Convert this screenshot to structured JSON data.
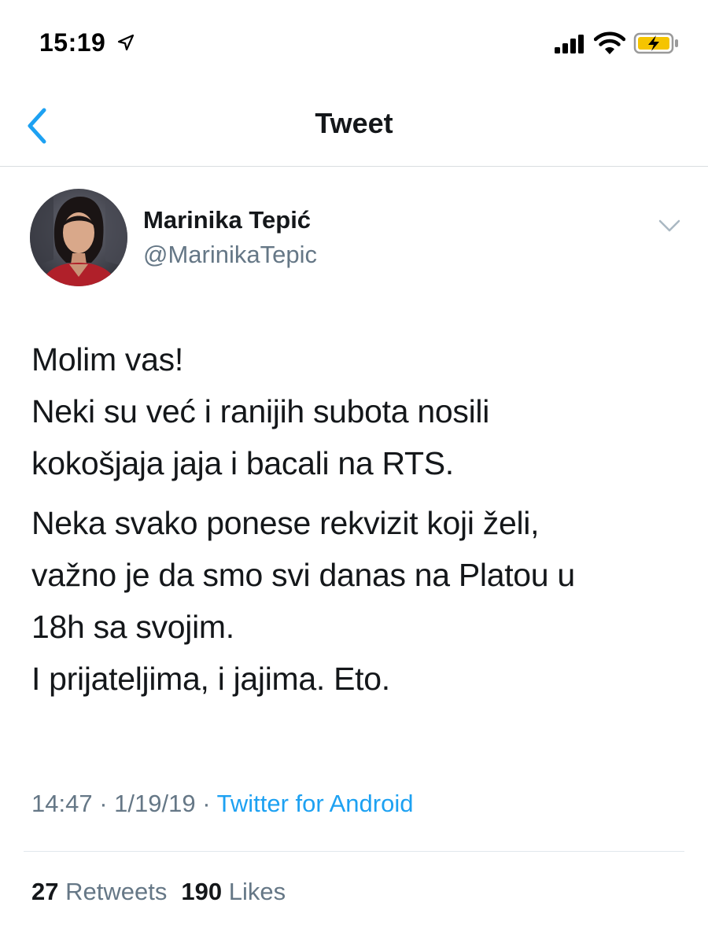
{
  "status_bar": {
    "time": "15:19"
  },
  "nav": {
    "title": "Tweet"
  },
  "author": {
    "name": "Marinika Tepić",
    "handle": "@MarinikaTepic"
  },
  "tweet": {
    "paragraphs": [
      [
        "Molim vas!",
        "Neki su već i ranijih subota nosili",
        "kokošjaja jaja i bacali na RTS."
      ],
      [
        "Neka svako ponese rekvizit koji želi,",
        "važno je da smo svi danas na Platou u",
        "18h sa svojim.",
        "I prijateljima, i jajima. Eto."
      ]
    ],
    "time": "14:47",
    "date": "1/19/19",
    "separator": "·",
    "source": "Twitter for Android"
  },
  "stats": {
    "retweets_count": "27",
    "retweets_label": "Retweets",
    "likes_count": "190",
    "likes_label": "Likes"
  },
  "colors": {
    "accent": "#1da1f2",
    "text": "#14171a",
    "secondary": "#657786"
  },
  "icons": {
    "location": "location-arrow-icon",
    "signal": "cellular-signal-icon",
    "wifi": "wifi-icon",
    "battery": "battery-charging-icon",
    "back": "chevron-left-icon",
    "caret": "chevron-down-icon"
  }
}
